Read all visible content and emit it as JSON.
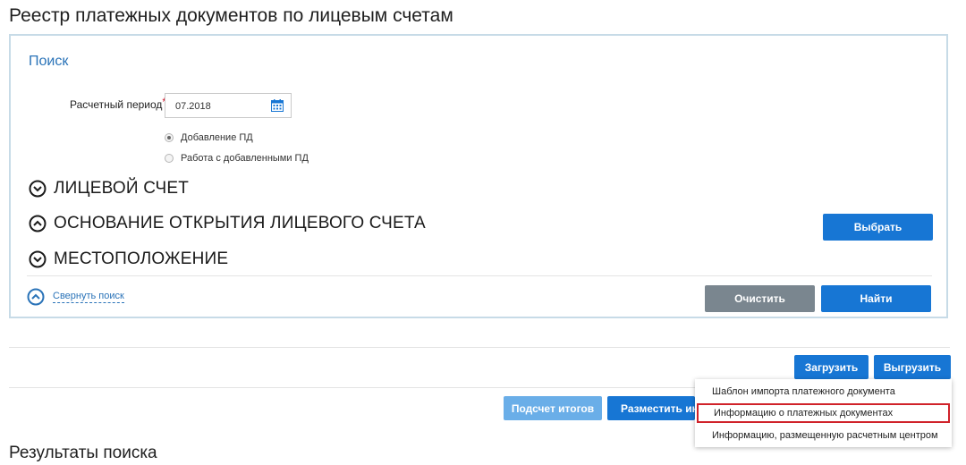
{
  "page": {
    "title": "Реестр платежных документов по лицевым счетам"
  },
  "search": {
    "heading": "Поиск",
    "period_label": "Расчетный период",
    "required_mark": "*",
    "period_value": "07.2018",
    "radio_options": [
      {
        "label": "Добавление ПД",
        "checked": true
      },
      {
        "label": "Работа с добавленными ПД",
        "checked": false
      }
    ],
    "sections": [
      {
        "label": "ЛИЦЕВОЙ СЧЕТ",
        "state": "collapsed"
      },
      {
        "label": "ОСНОВАНИЕ ОТКРЫТИЯ ЛИЦЕВОГО СЧЕТА",
        "state": "expanded"
      },
      {
        "label": "МЕСТОПОЛОЖЕНИЕ",
        "state": "collapsed"
      }
    ],
    "select_button": "Выбрать",
    "collapse_link": "Свернуть поиск",
    "clear_button": "Очистить",
    "find_button": "Найти"
  },
  "toolbar": {
    "upload_button": "Загрузить",
    "export_button": "Выгрузить",
    "totals_button": "Подсчет итогов",
    "publish_button": "Разместить инф"
  },
  "export_menu": {
    "items": [
      "Шаблон импорта платежного документа",
      "Информацию о платежных документах",
      "Информацию, размещенную расчетным центром"
    ],
    "highlighted_index": 1
  },
  "results": {
    "title": "Результаты поиска"
  },
  "colors": {
    "primary": "#1776d4",
    "secondary": "#7a868f",
    "disabled": "#6aaee8",
    "link": "#2a73b8",
    "panel_border": "#c7dbe7",
    "highlight": "#d0222a"
  }
}
